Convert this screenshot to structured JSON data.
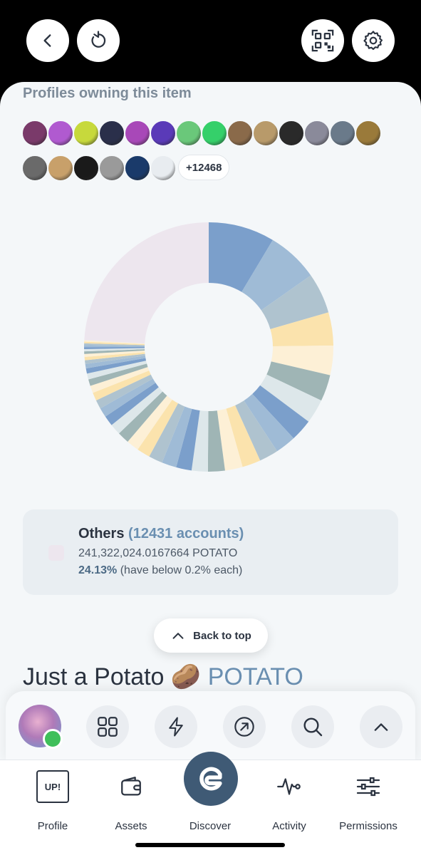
{
  "section_heading": "Profiles owning this item",
  "more_holders": "+12468",
  "avatars_row1": [
    "#7a3a6a",
    "#b05ad0",
    "#c7d93c",
    "#2a2f4a",
    "#a848b8",
    "#5a3ab8",
    "#6ac87a",
    "#35d06a",
    "#8a6a4a",
    "#b89a6a",
    "#2a2a2a",
    "#8a8a9a",
    "#6a7a8a",
    "#9a7a3a"
  ],
  "avatars_row2": [
    "#6a6a6a",
    "#c8a06a",
    "#1a1a1a",
    "#9a9a9a",
    "#1a3a6a",
    "#e8ecf0"
  ],
  "legend": {
    "label": "Others",
    "accounts": "(12431 accounts)",
    "amount": "241,322,024.0167664 POTATO",
    "percent": "24.13%",
    "note": "(have below 0.2% each)",
    "color": "#ede6ee"
  },
  "back_to_top": "Back to top",
  "token": {
    "name": "Just a Potato 🥔",
    "symbol": "POTATO"
  },
  "dock": {
    "icons": [
      "grid-icon",
      "bolt-icon",
      "arrow-circle-icon",
      "search-icon",
      "chevron-up-icon"
    ]
  },
  "tabs": {
    "profile": "Profile",
    "profile_badge": "UP!",
    "assets": "Assets",
    "discover": "Discover",
    "activity": "Activity",
    "permissions": "Permissions"
  },
  "colors": {
    "accent": "#6a8fb1",
    "discover": "#3f5a75",
    "others_slice": "#ede6ee"
  },
  "chart_data": {
    "type": "pie",
    "title": "",
    "categories": [
      "Others"
    ],
    "values": [
      24.13
    ],
    "palette": [
      "#7b9fcb",
      "#9fbbd6",
      "#afc3cf",
      "#fbe3ad",
      "#fdf0d6",
      "#9fb5b5",
      "#dde7ea"
    ]
  }
}
